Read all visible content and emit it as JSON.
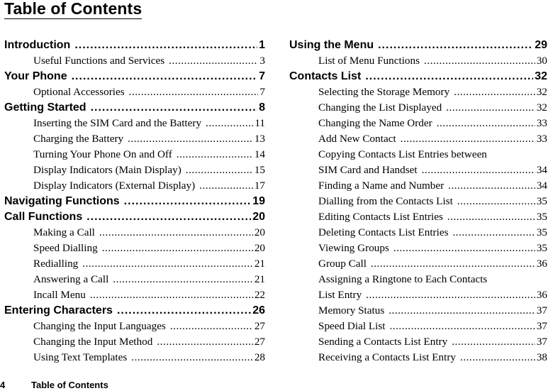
{
  "title": "Table of Contents",
  "left_column": [
    {
      "type": "chapter",
      "label": "Introduction",
      "page": "1"
    },
    {
      "type": "section",
      "label": "Useful Functions and Services",
      "page": "3"
    },
    {
      "type": "chapter",
      "label": "Your Phone",
      "page": "7"
    },
    {
      "type": "section",
      "label": "Optional Accessories",
      "page": "7"
    },
    {
      "type": "chapter",
      "label": "Getting Started",
      "page": "8"
    },
    {
      "type": "section",
      "label": "Inserting the SIM Card and the Battery",
      "page": "11"
    },
    {
      "type": "section",
      "label": "Charging the Battery",
      "page": "13"
    },
    {
      "type": "section",
      "label": "Turning Your Phone On and Off",
      "page": "14"
    },
    {
      "type": "section",
      "label": "Display Indicators (Main Display)",
      "page": "15"
    },
    {
      "type": "section",
      "label": "Display Indicators (External Display)",
      "page": "17"
    },
    {
      "type": "chapter",
      "label": "Navigating Functions",
      "page": "19"
    },
    {
      "type": "chapter",
      "label": "Call Functions",
      "page": "20"
    },
    {
      "type": "section",
      "label": "Making a Call",
      "page": "20"
    },
    {
      "type": "section",
      "label": "Speed Dialling",
      "page": "20"
    },
    {
      "type": "section",
      "label": "Redialling",
      "page": "21"
    },
    {
      "type": "section",
      "label": "Answering a Call",
      "page": "21"
    },
    {
      "type": "section",
      "label": "Incall Menu",
      "page": "22"
    },
    {
      "type": "chapter",
      "label": "Entering Characters",
      "page": "26"
    },
    {
      "type": "section",
      "label": "Changing the Input Languages",
      "page": "27"
    },
    {
      "type": "section",
      "label": "Changing the Input Method",
      "page": "27"
    },
    {
      "type": "section",
      "label": "Using Text Templates",
      "page": "28"
    }
  ],
  "right_column": [
    {
      "type": "chapter",
      "label": "Using the Menu",
      "page": "29"
    },
    {
      "type": "section",
      "label": "List of Menu Functions",
      "page": "30"
    },
    {
      "type": "chapter",
      "label": "Contacts List",
      "page": "32"
    },
    {
      "type": "section",
      "label": "Selecting the Storage Memory",
      "page": "32"
    },
    {
      "type": "section",
      "label": "Changing the List Displayed",
      "page": "32"
    },
    {
      "type": "section",
      "label": "Changing the Name Order",
      "page": "33"
    },
    {
      "type": "section",
      "label": "Add New Contact",
      "page": "33"
    },
    {
      "type": "section-line",
      "label": "Copying Contacts List Entries between"
    },
    {
      "type": "section",
      "label": "SIM Card and Handset",
      "page": "34"
    },
    {
      "type": "section",
      "label": "Finding a Name and Number",
      "page": "34"
    },
    {
      "type": "section",
      "label": "Dialling from the Contacts List",
      "page": "35"
    },
    {
      "type": "section",
      "label": "Editing Contacts List Entries",
      "page": "35"
    },
    {
      "type": "section",
      "label": "Deleting Contacts List Entries",
      "page": "35"
    },
    {
      "type": "section",
      "label": "Viewing Groups",
      "page": "35"
    },
    {
      "type": "section",
      "label": "Group Call",
      "page": "36"
    },
    {
      "type": "section-line",
      "label": "Assigning a Ringtone to Each Contacts"
    },
    {
      "type": "section",
      "label": "List Entry",
      "page": "36"
    },
    {
      "type": "section",
      "label": "Memory Status",
      "page": "37"
    },
    {
      "type": "section",
      "label": "Speed Dial List",
      "page": "37"
    },
    {
      "type": "section",
      "label": "Sending a Contacts List Entry",
      "page": "37"
    },
    {
      "type": "section",
      "label": "Receiving a Contacts List Entry",
      "page": "38"
    }
  ],
  "footer": {
    "page_number": "4",
    "section_title": "Table of Contents"
  }
}
